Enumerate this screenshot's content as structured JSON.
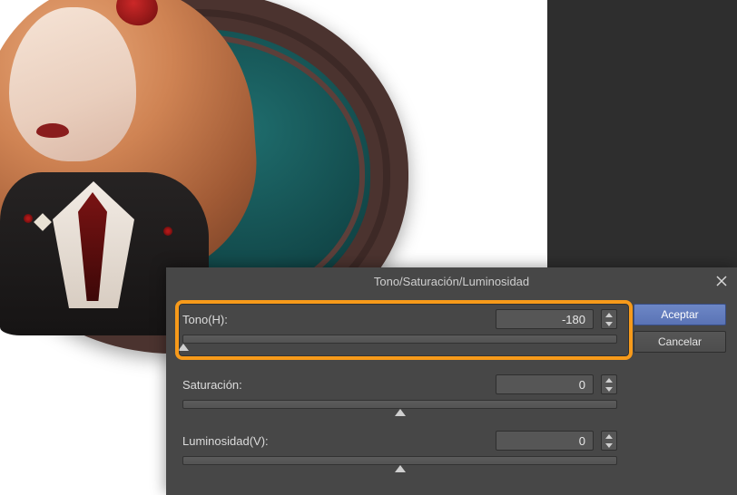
{
  "dialog": {
    "title": "Tono/Saturación/Luminosidad",
    "buttons": {
      "ok": "Aceptar",
      "cancel": "Cancelar"
    },
    "sliders": {
      "hue": {
        "label": "Tono(H):",
        "value": "-180",
        "min": -180,
        "max": 180,
        "pos_pct": 0
      },
      "saturation": {
        "label": "Saturación:",
        "value": "0",
        "min": -100,
        "max": 100,
        "pos_pct": 50
      },
      "lightness": {
        "label": "Luminosidad(V):",
        "value": "0",
        "min": -100,
        "max": 100,
        "pos_pct": 50
      }
    }
  },
  "chart_data": {
    "type": "table",
    "title": "Hue/Saturation/Lightness adjustment values",
    "series": [
      {
        "name": "Tono(H)",
        "values": [
          -180
        ],
        "range": [
          -180,
          180
        ]
      },
      {
        "name": "Saturación",
        "values": [
          0
        ],
        "range": [
          -100,
          100
        ]
      },
      {
        "name": "Luminosidad(V)",
        "values": [
          0
        ],
        "range": [
          -100,
          100
        ]
      }
    ]
  }
}
